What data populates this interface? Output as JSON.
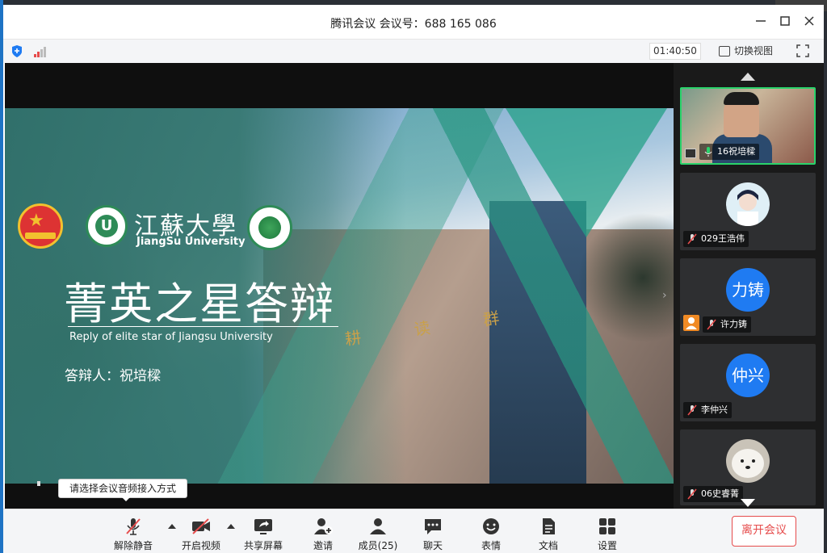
{
  "window": {
    "title": "腾讯会议 会议号：688 165 086",
    "minimize_icon": "minimize-icon",
    "maximize_icon": "maximize-icon",
    "close_icon": "close-icon"
  },
  "infobar": {
    "security_icon": "shield-icon",
    "signal_icon": "signal-bars-icon",
    "timer": "01:40:50",
    "switch_view_label": "切换视图",
    "fullscreen_icon": "fullscreen-icon"
  },
  "slide": {
    "university_name": "江蘇大學",
    "university_en": "JiangSu University",
    "title_cn": "菁英之星答辩",
    "title_en": "Reply of elite star of Jiangsu University",
    "presenter": "答辩人：祝培樑",
    "plaque": "耕 读 群"
  },
  "tooltip": "请选择会议音频接入方式",
  "participants": [
    {
      "name": "16祝培樑",
      "type": "video",
      "active": true
    },
    {
      "name": "029王浩伟",
      "type": "avatar-image"
    },
    {
      "name": "许力铸",
      "type": "initials",
      "initials": "力铸",
      "host": true
    },
    {
      "name": "李仲兴",
      "type": "initials",
      "initials": "仲兴"
    },
    {
      "name": "06史睿菁",
      "type": "avatar-image"
    }
  ],
  "toolbar": {
    "unmute": "解除静音",
    "start_video": "开启视频",
    "share_screen": "共享屏幕",
    "invite": "邀请",
    "members": "成员(25)",
    "chat": "聊天",
    "reactions": "表情",
    "docs": "文档",
    "settings": "设置",
    "leave": "离开会议"
  },
  "colors": {
    "accent_blue": "#1f7bf2",
    "leave_red": "#e64c4c",
    "active_green": "#2ad36b"
  }
}
